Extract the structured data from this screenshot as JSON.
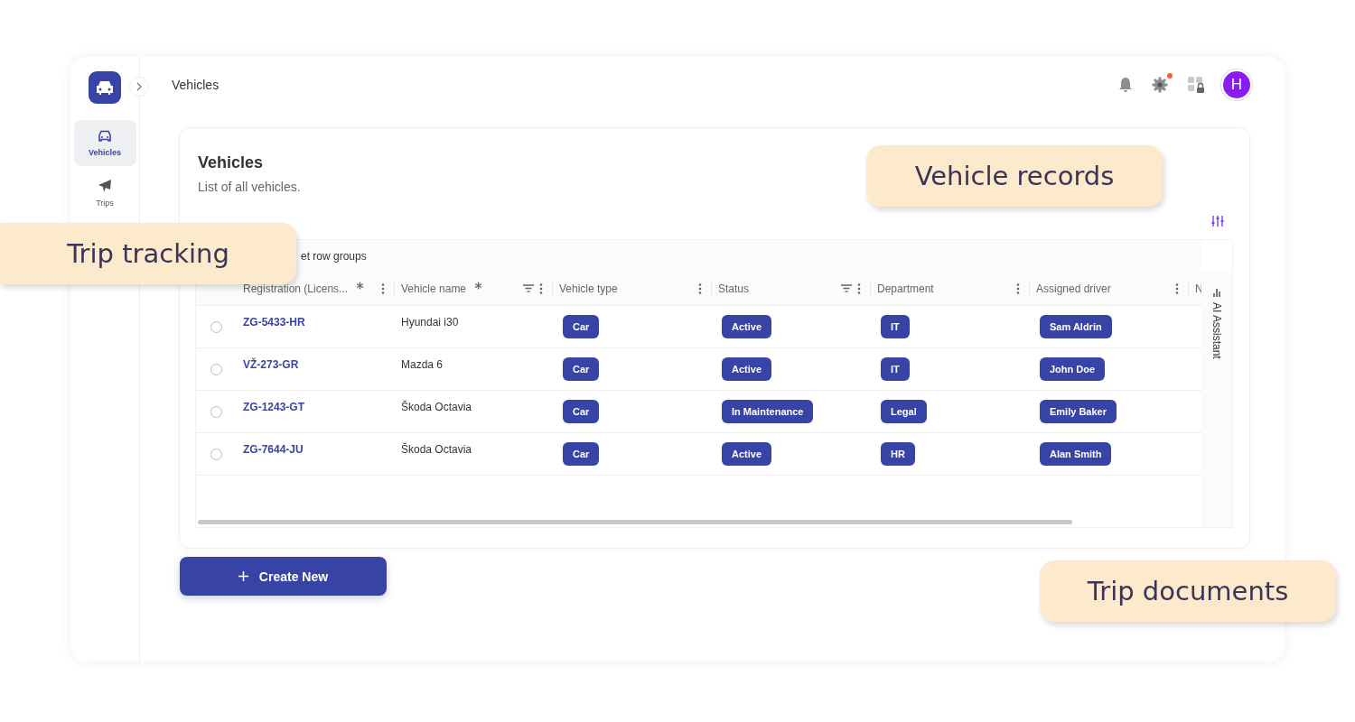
{
  "header": {
    "title": "Vehicles",
    "avatar": "H",
    "notification_dot": true
  },
  "sidebar": {
    "items": [
      {
        "label": "Vehicles",
        "selected": true
      },
      {
        "label": "Trips",
        "selected": false
      }
    ]
  },
  "card": {
    "title": "Vehicles",
    "subtitle": "List of all vehicles.",
    "group_bar": "et row groups",
    "columns": [
      {
        "label": "Registration (Licens...",
        "kind": "link",
        "required": true,
        "filter": false,
        "menu": true
      },
      {
        "label": "Vehicle name",
        "kind": "text",
        "required": true,
        "filter": true,
        "menu": true
      },
      {
        "label": "Vehicle type",
        "kind": "pill",
        "required": false,
        "filter": false,
        "menu": true
      },
      {
        "label": "Status",
        "kind": "pill",
        "required": false,
        "filter": true,
        "menu": true
      },
      {
        "label": "Department",
        "kind": "pill",
        "required": false,
        "filter": false,
        "menu": true
      },
      {
        "label": "Assigned driver",
        "kind": "pill",
        "required": false,
        "filter": false,
        "menu": true
      },
      {
        "label": "N"
      }
    ],
    "rows": [
      {
        "selected": false,
        "cells": [
          "ZG-5433-HR",
          "Hyundai i30",
          "Car",
          "Active",
          "IT",
          "Sam Aldrin"
        ]
      },
      {
        "selected": false,
        "cells": [
          "VŽ-273-GR",
          "Mazda 6",
          "Car",
          "Active",
          "IT",
          "John Doe"
        ]
      },
      {
        "selected": false,
        "cells": [
          "ZG-1243-GT",
          "Škoda Octavia",
          "Car",
          "In Maintenance",
          "Legal",
          "Emily Baker"
        ]
      },
      {
        "selected": false,
        "cells": [
          "ZG-7644-JU",
          "Škoda Octavia",
          "Car",
          "Active",
          "HR",
          "Alan Smith"
        ]
      }
    ],
    "side_panel": "AI Assistant"
  },
  "create_button": {
    "label": "Create New"
  },
  "callouts": [
    {
      "text": "Trip tracking"
    },
    {
      "text": "Vehicle records"
    },
    {
      "text": "Trip documents"
    }
  ]
}
